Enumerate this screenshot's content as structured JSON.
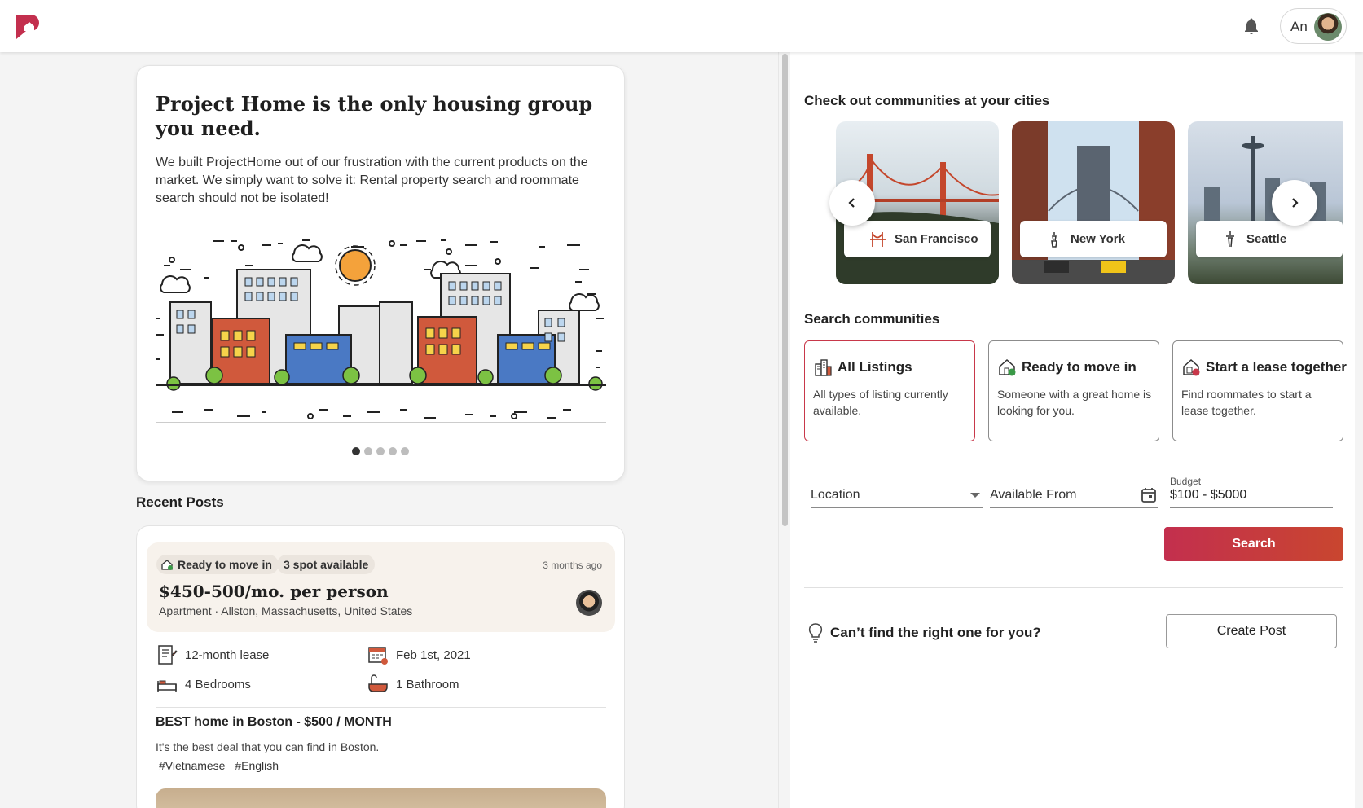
{
  "header": {
    "user_name": "An"
  },
  "hero": {
    "title": "Project Home is the only housing group you need.",
    "text": "We built ProjectHome out of our frustration with the current products on the market. We simply want to solve it: Rental property search and roommate search should not be isolated!",
    "slides_total": 5,
    "active_slide": 1
  },
  "recent_posts": {
    "title": "Recent Posts",
    "post": {
      "chip_type": "Ready to move in",
      "chip_spots": "3 spot available",
      "time": "3 months ago",
      "price": "$450-500/mo. per person",
      "location": "Apartment · Allston, Massachusetts, United States",
      "lease": "12-month lease",
      "available_date": "Feb 1st, 2021",
      "bedrooms": "4 Bedrooms",
      "bathrooms": "1 Bathroom",
      "heading": "BEST home in Boston - $500 / MONTH",
      "description": "It's the best deal that you can find in Boston.",
      "tags": [
        "#Vietnamese",
        "#English"
      ]
    }
  },
  "cities": {
    "title": "Check out communities at your cities",
    "items": [
      {
        "name": "San Francisco",
        "icon": "golden-gate-icon"
      },
      {
        "name": "New York",
        "icon": "statue-of-liberty-icon"
      },
      {
        "name": "Seattle",
        "icon": "space-needle-icon"
      }
    ]
  },
  "communities": {
    "title": "Search communities",
    "items": [
      {
        "name": "All Listings",
        "desc": "All types of listing currently available."
      },
      {
        "name": "Ready to move in",
        "desc": "Someone with a great home is looking for you."
      },
      {
        "name": "Start a lease together",
        "desc": "Find roommates to start a lease together."
      }
    ],
    "selected_index": 0
  },
  "search": {
    "location_placeholder": "Location",
    "date_placeholder": "Available From",
    "budget_label": "Budget",
    "budget_value": "$100 - $5000",
    "button_label": "Search"
  },
  "cta": {
    "text": "Can’t find the right one for you?",
    "button_label": "Create Post"
  },
  "colors": {
    "brand": "#c32f4e",
    "accent_orange": "#c9462f",
    "selected_border": "#c8384a"
  }
}
